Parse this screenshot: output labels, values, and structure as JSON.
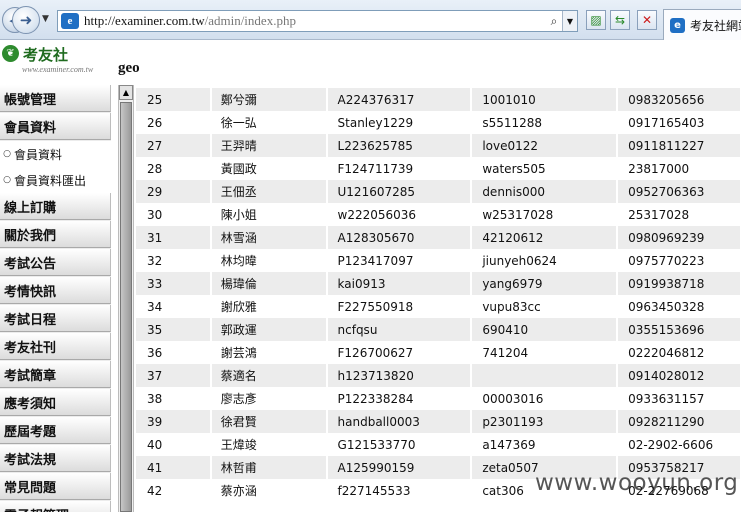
{
  "browser": {
    "address_host": "http://examiner.com.tw",
    "address_path": "/admin/index.php",
    "tab_label": "考友社網站"
  },
  "site": {
    "brand": "考友社",
    "brand_url": "www.examiner.com.tw",
    "page_title": "geo"
  },
  "sidebar": {
    "items": [
      {
        "label": "帳號管理",
        "type": "menu"
      },
      {
        "label": "會員資料",
        "type": "menu"
      },
      {
        "label": "會員資料",
        "type": "sub"
      },
      {
        "label": "會員資料匯出",
        "type": "sub"
      },
      {
        "label": "線上訂購",
        "type": "menu"
      },
      {
        "label": "關於我們",
        "type": "menu"
      },
      {
        "label": "考試公告",
        "type": "menu"
      },
      {
        "label": "考情快訊",
        "type": "menu"
      },
      {
        "label": "考試日程",
        "type": "menu"
      },
      {
        "label": "考友社刊",
        "type": "menu"
      },
      {
        "label": "考試簡章",
        "type": "menu"
      },
      {
        "label": "應考須知",
        "type": "menu"
      },
      {
        "label": "歷屆考題",
        "type": "menu"
      },
      {
        "label": "考試法規",
        "type": "menu"
      },
      {
        "label": "常見問題",
        "type": "menu"
      },
      {
        "label": "電子報管理",
        "type": "menu"
      }
    ]
  },
  "table": {
    "rows": [
      {
        "no": "25",
        "name": "鄭兮彌",
        "id": "A224376317",
        "pw": "1001010",
        "phone": "0983205656"
      },
      {
        "no": "26",
        "name": "徐一弘",
        "id": "Stanley1229",
        "pw": "s5511288",
        "phone": "0917165403"
      },
      {
        "no": "27",
        "name": "王羿晴",
        "id": "L223625785",
        "pw": "love0122",
        "phone": "0911811227"
      },
      {
        "no": "28",
        "name": "黃國政",
        "id": "F124711739",
        "pw": "waters505",
        "phone": "23817000"
      },
      {
        "no": "29",
        "name": "王佃丞",
        "id": "U121607285",
        "pw": "dennis000",
        "phone": "0952706363"
      },
      {
        "no": "30",
        "name": "陳小姐",
        "id": "w222056036",
        "pw": "w25317028",
        "phone": "25317028"
      },
      {
        "no": "31",
        "name": "林雪涵",
        "id": "A128305670",
        "pw": "42120612",
        "phone": "0980969239"
      },
      {
        "no": "32",
        "name": "林均暐",
        "id": "P123417097",
        "pw": "jiunyeh0624",
        "phone": "0975770223"
      },
      {
        "no": "33",
        "name": "楊瑋倫",
        "id": "kai0913",
        "pw": "yang6979",
        "phone": "0919938718"
      },
      {
        "no": "34",
        "name": "謝欣雅",
        "id": "F227550918",
        "pw": "vupu83cc",
        "phone": "0963450328"
      },
      {
        "no": "35",
        "name": "郭政運",
        "id": "ncfqsu",
        "pw": "690410",
        "phone": "0355153696"
      },
      {
        "no": "36",
        "name": "謝芸鴻",
        "id": "F126700627",
        "pw": "741204",
        "phone": "0222046812"
      },
      {
        "no": "37",
        "name": "蔡適名",
        "id": "h123713820",
        "pw": "",
        "phone": "0914028012"
      },
      {
        "no": "38",
        "name": "廖志彥",
        "id": "P122338284",
        "pw": "00003016",
        "phone": "0933631157"
      },
      {
        "no": "39",
        "name": "徐君賢",
        "id": "handball0003",
        "pw": "p2301193",
        "phone": "0928211290"
      },
      {
        "no": "40",
        "name": "王煒竣",
        "id": "G121533770",
        "pw": "a147369",
        "phone": "02-2902-6606"
      },
      {
        "no": "41",
        "name": "林哲甫",
        "id": "A125990159",
        "pw": "zeta0507",
        "phone": "0953758217"
      },
      {
        "no": "42",
        "name": "蔡亦涵",
        "id": "f227145533",
        "pw": "cat306",
        "phone": "02-22769068"
      }
    ]
  },
  "watermark": "www.wooyun.org",
  "colors": {
    "row_alt": "#ececec",
    "brand_green": "#1f6b1f",
    "sidebar_bg": "#ececec"
  }
}
